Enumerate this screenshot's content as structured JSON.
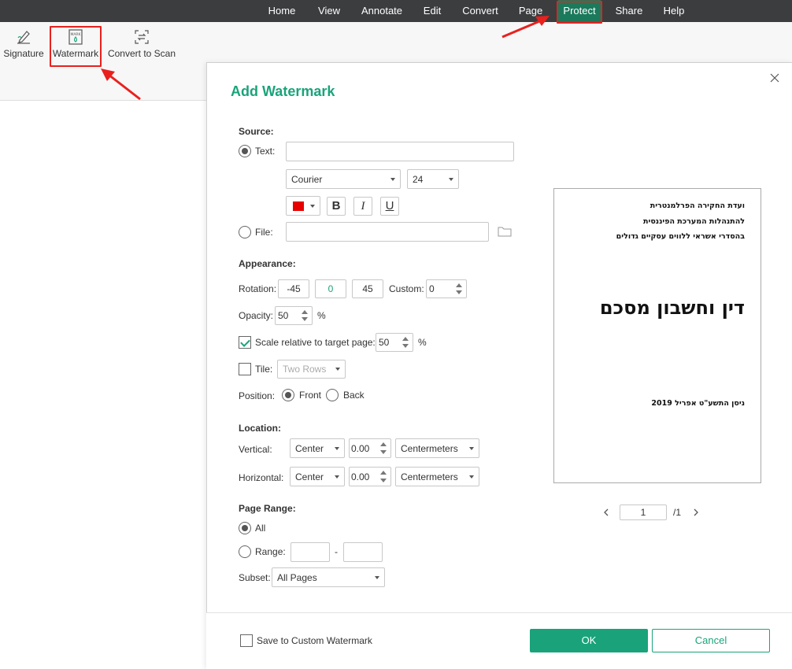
{
  "menu": {
    "items": [
      {
        "label": "Home"
      },
      {
        "label": "View"
      },
      {
        "label": "Annotate"
      },
      {
        "label": "Edit"
      },
      {
        "label": "Convert"
      },
      {
        "label": "Page"
      },
      {
        "label": "Protect"
      },
      {
        "label": "Share"
      },
      {
        "label": "Help"
      }
    ],
    "active": "Protect"
  },
  "ribbon": {
    "signature": "Signature",
    "watermark": "Watermark",
    "watermark_icon_text": "MARK",
    "convert_to_scan": "Convert to Scan"
  },
  "dialog": {
    "title": "Add Watermark",
    "source": {
      "heading": "Source:",
      "text_label": "Text:",
      "text_value": "",
      "font": "Courier",
      "font_size": "24",
      "color": "#e60000",
      "bold": "B",
      "italic": "I",
      "underline": "U",
      "file_label": "File:",
      "file_value": "",
      "selected": "text"
    },
    "appearance": {
      "heading": "Appearance:",
      "rotation_label": "Rotation:",
      "rotation_options": [
        "-45",
        "0",
        "45"
      ],
      "rotation_selected": "0",
      "custom_label": "Custom:",
      "custom_value": "0",
      "opacity_label": "Opacity:",
      "opacity_value": "50",
      "opacity_unit": "%",
      "scale_label": "Scale relative to target page:",
      "scale_checked": true,
      "scale_value": "50",
      "scale_unit": "%",
      "tile_label": "Tile:",
      "tile_checked": false,
      "tile_value": "Two Rows",
      "position_label": "Position:",
      "position_front": "Front",
      "position_back": "Back",
      "position_selected": "Front"
    },
    "location": {
      "heading": "Location:",
      "vertical_label": "Vertical:",
      "vertical_align": "Center",
      "vertical_value": "0.00",
      "vertical_unit": "Centermeters",
      "horizontal_label": "Horizontal:",
      "horizontal_align": "Center",
      "horizontal_value": "0.00",
      "horizontal_unit": "Centermeters"
    },
    "page_range": {
      "heading": "Page Range:",
      "all_label": "All",
      "range_label": "Range:",
      "range_from": "",
      "range_sep": "-",
      "range_to": "",
      "subset_label": "Subset:",
      "subset_value": "All Pages",
      "selected": "all"
    },
    "preview": {
      "line1": "ועדת החקירה הפרלמנטרית",
      "line2": "להתנהלות המערכת הפיננסית",
      "line3": "בהסדרי אשראי ללווים עסקיים גדולים",
      "heading": "דין וחשבון מסכם",
      "date": "ניסן התשע\"ט   אפריל 2019",
      "page_current": "1",
      "page_total": "/1"
    },
    "footer": {
      "save_custom_label": "Save to Custom Watermark",
      "ok": "OK",
      "cancel": "Cancel"
    }
  },
  "colors": {
    "accent": "#1aa37a",
    "menubar": "#3c3d3f",
    "menu_active": "#1b7a5c",
    "highlight": "#e8211f"
  }
}
